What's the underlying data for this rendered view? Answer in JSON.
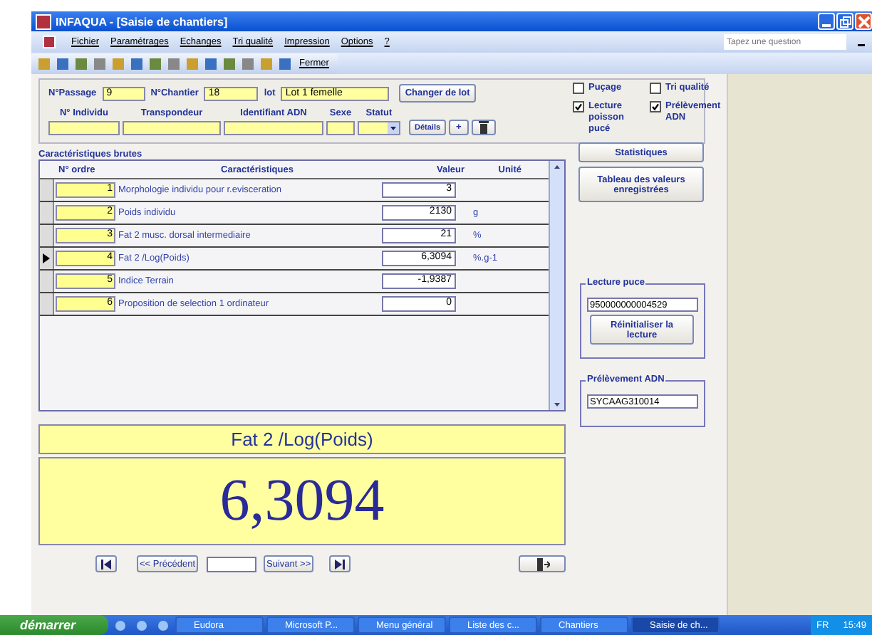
{
  "window": {
    "title": "INFAQUA - [Saisie de chantiers]"
  },
  "menu": [
    "Fichier",
    "Paramétrages",
    "Echanges",
    "Tri qualité",
    "Impression",
    "Options",
    "?"
  ],
  "help_box": {
    "placeholder": "Tapez une question"
  },
  "toolbar": {
    "close_label": "Fermer"
  },
  "header": {
    "passage_label": "N°Passage",
    "passage": "9",
    "chantier_label": "N°Chantier",
    "chantier": "18",
    "lot_label": "lot",
    "lot": "Lot 1 femelle",
    "change_lot": "Changer de lot",
    "checks": [
      {
        "label": "Puçage",
        "checked": false
      },
      {
        "label": "Tri qualité",
        "checked": false
      },
      {
        "label": "Lecture poisson pucé",
        "checked": true
      },
      {
        "label": "Prélèvement ADN",
        "checked": true
      }
    ],
    "fields": [
      "N° Individu",
      "Transpondeur",
      "Identifiant ADN",
      "Sexe",
      "Statut"
    ],
    "details": "Détails",
    "add": "+"
  },
  "grid": {
    "title": "Caractéristiques brutes",
    "columns": [
      "N° ordre",
      "Caractéristiques",
      "Valeur",
      "Unité"
    ],
    "rows": [
      {
        "order": "1",
        "name": "Morphologie individu pour r.evisceration",
        "value": "3",
        "unit": "",
        "selected": false
      },
      {
        "order": "2",
        "name": "Poids individu",
        "value": "2130",
        "unit": "g",
        "selected": false
      },
      {
        "order": "3",
        "name": "Fat 2 musc. dorsal intermediaire",
        "value": "21",
        "unit": "%",
        "selected": false
      },
      {
        "order": "4",
        "name": "Fat 2 /Log(Poids)",
        "value": "6,3094",
        "unit": "%.g-1",
        "selected": true
      },
      {
        "order": "5",
        "name": "Indice Terrain",
        "value": "-1,9387",
        "unit": "",
        "selected": false
      },
      {
        "order": "6",
        "name": "Proposition de selection 1 ordinateur",
        "value": "0",
        "unit": "",
        "selected": false
      }
    ]
  },
  "side": {
    "stats": "Statistiques",
    "table": "Tableau des valeurs enregistrées",
    "puce_title": "Lecture puce",
    "puce_value": "950000000004529",
    "reset": "Réinitialiser la lecture",
    "adn_title": "Prélèvement ADN",
    "adn_value": "SYCAAG310014"
  },
  "display": {
    "label": "Fat 2 /Log(Poids)",
    "value": "6,3094"
  },
  "nav": {
    "prev": "<< Précédent",
    "next": "Suivant >>"
  },
  "taskbar": {
    "start": "démarrer",
    "items": [
      {
        "label": "Eudora",
        "selected": false
      },
      {
        "label": "Microsoft P...",
        "selected": false
      },
      {
        "label": "Menu général",
        "selected": false
      },
      {
        "label": "Liste des c...",
        "selected": false
      },
      {
        "label": "Chantiers",
        "selected": false
      },
      {
        "label": "Saisie de ch...",
        "selected": true
      }
    ],
    "lang": "FR",
    "clock": "15:49"
  }
}
